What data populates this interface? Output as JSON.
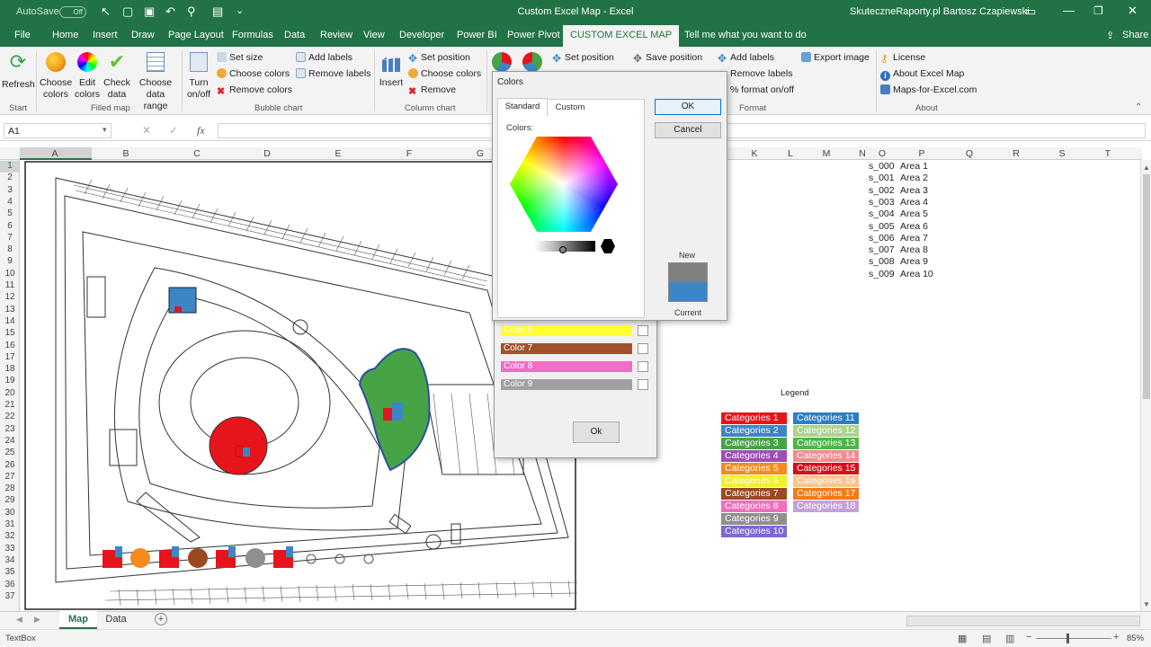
{
  "titlebar": {
    "autosave": "AutoSave",
    "autosave_state": "Off",
    "title": "Custom Excel Map  -  Excel",
    "user": "SkuteczneRaporty.pl Bartosz Czapiewski"
  },
  "tabs": [
    "File",
    "Home",
    "Insert",
    "Draw",
    "Page Layout",
    "Formulas",
    "Data",
    "Review",
    "View",
    "Developer",
    "Power BI",
    "Power Pivot",
    "CUSTOM EXCEL MAP"
  ],
  "tell_me": "Tell me what you want to do",
  "share": "Share",
  "ribbon": {
    "refresh": "Refresh",
    "choose_colors": "Choose colors",
    "edit_colors": "Edit colors",
    "check_data": "Check data",
    "choose_data_range": "Choose data range",
    "turn_on_off": "Turn on/off",
    "set_size": "Set size",
    "bubble_choose_colors": "Choose colors",
    "bubble_remove_colors": "Remove colors",
    "add_labels": "Add labels",
    "remove_labels": "Remove labels",
    "insert": "Insert",
    "set_position": "Set position",
    "column_choose_colors": "Choose colors",
    "remove": "Remove",
    "set_position2": "Set position",
    "save_position": "Save position",
    "add_labels2": "Add labels",
    "remove_labels2": "Remove labels",
    "format_on_off": "% format on/off",
    "export_image": "Export image",
    "license": "License",
    "about": "About Excel Map",
    "maps_site": "Maps-for-Excel.com",
    "groups": {
      "start": "Start",
      "filled_map": "Filled map",
      "bubble_chart": "Bubble chart",
      "column_chart": "Column chart",
      "format": "Format",
      "about": "About"
    }
  },
  "formula_bar": {
    "name_box": "A1",
    "fx": "fx"
  },
  "columns": [
    "A",
    "B",
    "C",
    "D",
    "E",
    "F",
    "G",
    "K",
    "L",
    "M",
    "N",
    "O",
    "P",
    "Q",
    "R",
    "S",
    "T"
  ],
  "rows": [
    "1",
    "2",
    "3",
    "4",
    "5",
    "6",
    "7",
    "8",
    "9",
    "10",
    "11",
    "12",
    "13",
    "14",
    "15",
    "16",
    "17",
    "18",
    "19",
    "20",
    "21",
    "22",
    "23",
    "24",
    "25",
    "26",
    "27",
    "28",
    "29",
    "30",
    "31",
    "32",
    "33",
    "34",
    "35",
    "36",
    "37"
  ],
  "area_list": [
    {
      "id": "s_000",
      "name": "Area 1"
    },
    {
      "id": "s_001",
      "name": "Area 2"
    },
    {
      "id": "s_002",
      "name": "Area 3"
    },
    {
      "id": "s_003",
      "name": "Area 4"
    },
    {
      "id": "s_004",
      "name": "Area 5"
    },
    {
      "id": "s_005",
      "name": "Area 6"
    },
    {
      "id": "s_006",
      "name": "Area 7"
    },
    {
      "id": "s_007",
      "name": "Area 8"
    },
    {
      "id": "s_008",
      "name": "Area 9"
    },
    {
      "id": "s_009",
      "name": "Area 10"
    }
  ],
  "legend": {
    "title": "Legend",
    "left": [
      {
        "label": "Categories 1",
        "color": "#e8141b"
      },
      {
        "label": "Categories 2",
        "color": "#3d86c6"
      },
      {
        "label": "Categories 3",
        "color": "#47a446"
      },
      {
        "label": "Categories 4",
        "color": "#9c4fb7"
      },
      {
        "label": "Categories 5",
        "color": "#f58a1e"
      },
      {
        "label": "Categories 6",
        "color": "#f3ef2d"
      },
      {
        "label": "Categories 7",
        "color": "#9a4a22"
      },
      {
        "label": "Categories 8",
        "color": "#ef6ebd"
      },
      {
        "label": "Categories 9",
        "color": "#8f8f8f"
      },
      {
        "label": "Categories 10",
        "color": "#8066d6"
      }
    ],
    "right": [
      {
        "label": "Categories 11",
        "color": "#2f7dc0"
      },
      {
        "label": "Categories 12",
        "color": "#a9d48c"
      },
      {
        "label": "Categories 13",
        "color": "#4db747"
      },
      {
        "label": "Categories 14",
        "color": "#f18b91"
      },
      {
        "label": "Categories 15",
        "color": "#d4101b"
      },
      {
        "label": "Categories 16",
        "color": "#f7c58d"
      },
      {
        "label": "Categories 17",
        "color": "#f57a18"
      },
      {
        "label": "Categories 18",
        "color": "#c3a2dc"
      }
    ]
  },
  "color_editor": {
    "rows": [
      {
        "label": "Color 6",
        "color": "#ffff33"
      },
      {
        "label": "Color 7",
        "color": "#a0522d"
      },
      {
        "label": "Color 8",
        "color": "#f06cc5"
      },
      {
        "label": "Color 9",
        "color": "#a0a0a0"
      }
    ],
    "ok": "Ok"
  },
  "colors_dialog": {
    "title": "Colors",
    "tab_standard": "Standard",
    "tab_custom": "Custom",
    "colors_label": "Colors:",
    "ok": "OK",
    "cancel": "Cancel",
    "new_label": "New",
    "current_label": "Current",
    "new_color": "#808080",
    "current_color": "#3d86c6"
  },
  "sheet_tabs": [
    "Map",
    "Data"
  ],
  "status": {
    "left": "TextBox",
    "zoom": "85%"
  }
}
